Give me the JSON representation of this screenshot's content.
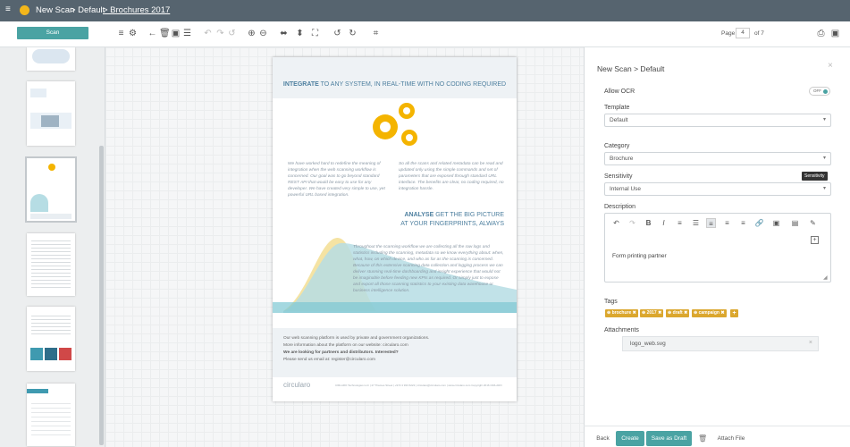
{
  "breadcrumb": {
    "part1": "New Scan",
    "part2": "> Default",
    "part3": "> Brochures 2017"
  },
  "toolbar": {
    "scan_label": "Scan",
    "page_label": "Page",
    "page_value": "4",
    "page_total": "of 7"
  },
  "document": {
    "headline_bold": "INTEGRATE",
    "headline_rest": "TO ANY SYSTEM, IN REAL-TIME WITH NO CODING REQUIRED",
    "col1": "We have worked hard to redefine the meaning of integration when the web scanning workflow is concerned. Our goal was to go beyond standard REST API that would be easy to use for any developer. We have created very simple to use, yet powerful URL based integration.",
    "col2": "So all the scans and related metadata can be read and updated only using the simple commands and set of parameters that are exposed through standard URL interface. The benefits are clear, no coding required, no integration hassle.",
    "analyse_bold": "ANALYSE",
    "analyse_rest": "GET THE BIG PICTURE",
    "analyse_line2": "AT YOUR FINGERPRINTS, ALWAYS",
    "analyse_text": "Throughout the scanning workflow we are collecting all the raw logs and statistics including the scanning, metadata so we know everything about: when, what, how, on which device, and who as far as the scanning is concerned. Because of this extensive scanning data collection and logging process we can deliver stunning real-time dashboarding and insight experience that would not be imaginable before feeding new KPIs as required. Or simply just to expose and export all those scanning statistics to your existing data warehouse or business intelligence solution.",
    "footer_line1": "Our web scanning platform is used by private and government organizations.",
    "footer_line2": "More information about the platform on our website: circularo.com",
    "footer_line3": "We are looking for partners and distributors. Interested?",
    "footer_line4": "Please send us email at: register@circularo.com",
    "logo": "circularo",
    "fine_print": "CIRLARO Technologies LLC | 47 Thames Street | +972 4 933 6222 | circularo@circularo.com | www.circularo.com  Copyright 2016 CIRLARO"
  },
  "panel": {
    "title": "New Scan > Default",
    "allow_ocr_label": "Allow OCR",
    "ocr_toggle": "OFF",
    "template_label": "Template",
    "template_value": "Default",
    "category_label": "Category",
    "category_value": "Brochure",
    "sensitivity_label": "Sensitivity",
    "sensitivity_value": "Internal Use",
    "sensitivity_tooltip": "Sensitivity",
    "description_label": "Description",
    "description_text": "Form printing partner",
    "tags_label": "Tags",
    "tags": [
      "brochure",
      "2017",
      "draft",
      "campaign"
    ],
    "attachments_label": "Attachments",
    "attachment_file": "logo_web.svg",
    "back": "Back",
    "create": "Create",
    "save_draft": "Save as Draft",
    "attach": "Attach File"
  },
  "colors": {
    "topbar": "#56646f",
    "accent": "#4aa3a3",
    "gear": "#f4b400",
    "tag": "#dba72e",
    "chart_teal": "#7ec8d3",
    "chart_yellow": "#f5e3a3"
  }
}
